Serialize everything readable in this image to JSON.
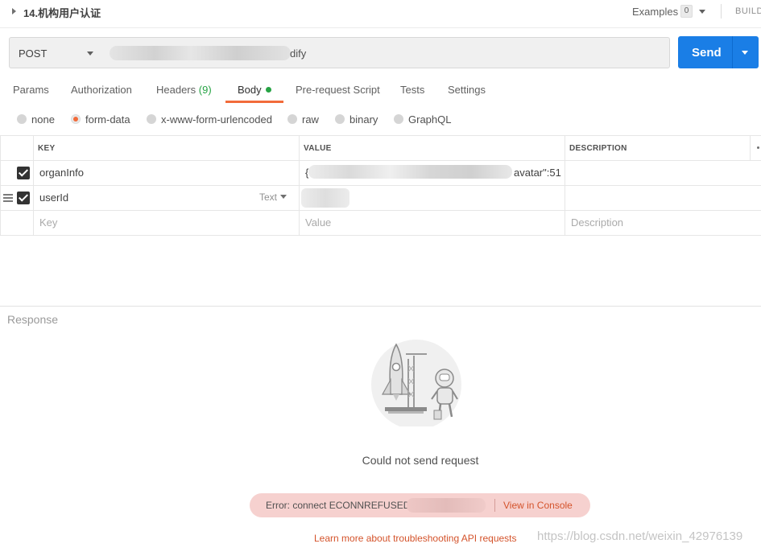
{
  "request": {
    "name": "14.机构用户认证",
    "examples_label": "Examples",
    "examples_count": "0",
    "build_label": "BUILD",
    "method": "POST",
    "url_visible_suffix": "dify",
    "send_label": "Send"
  },
  "tabs": [
    {
      "label": "Params"
    },
    {
      "label": "Authorization"
    },
    {
      "label": "Headers",
      "count": "(9)"
    },
    {
      "label": "Body",
      "active": true
    },
    {
      "label": "Pre-request Script"
    },
    {
      "label": "Tests"
    },
    {
      "label": "Settings"
    }
  ],
  "body_types": [
    {
      "label": "none"
    },
    {
      "label": "form-data",
      "selected": true
    },
    {
      "label": "x-www-form-urlencoded"
    },
    {
      "label": "raw"
    },
    {
      "label": "binary"
    },
    {
      "label": "GraphQL"
    }
  ],
  "table": {
    "headers": {
      "key": "KEY",
      "value": "VALUE",
      "description": "DESCRIPTION"
    },
    "rows": [
      {
        "checked": true,
        "key": "organInfo",
        "value_prefix": "{",
        "value_suffix": "avatar\":51"
      },
      {
        "checked": true,
        "key": "userId",
        "type": "Text"
      }
    ],
    "placeholders": {
      "key": "Key",
      "value": "Value",
      "description": "Description"
    }
  },
  "response": {
    "title": "Response",
    "empty_message": "Could not send request",
    "error_text": "Error: connect ECONNREFUSED",
    "view_console": "View in Console",
    "learn_more": "Learn more about troubleshooting API requests"
  },
  "watermark": "https://blog.csdn.net/weixin_42976139",
  "colors": {
    "accent": "#f26b3a",
    "send_button": "#1a7ee6",
    "success_green": "#26a344",
    "error_bg": "#f6d1cf",
    "link_red": "#d4532b"
  },
  "icons": [
    "caret-right-icon",
    "chevron-down-icon",
    "drag-handle-icon",
    "checkbox-icon",
    "rocket-illustration"
  ]
}
